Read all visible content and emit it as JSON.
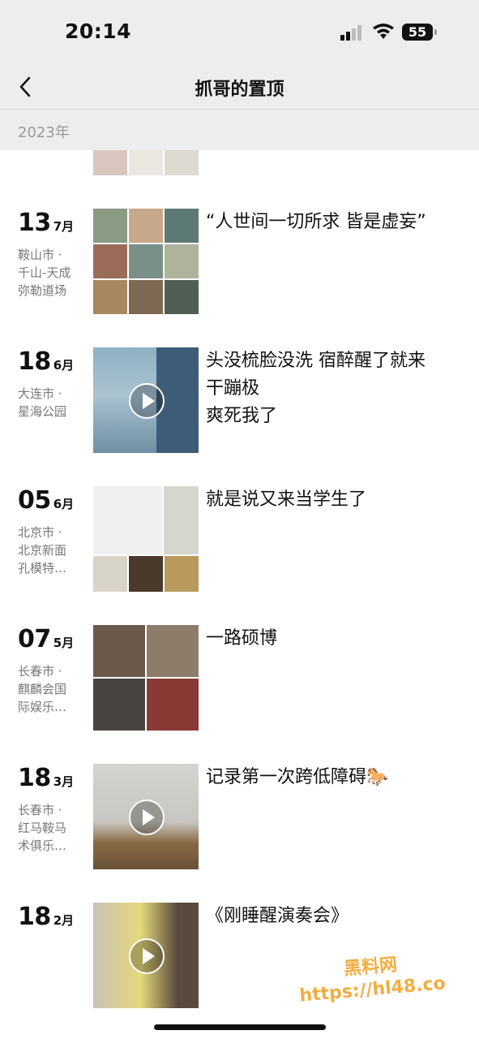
{
  "status_bar": {
    "time": "20:14",
    "battery": "55"
  },
  "nav": {
    "title": "抓哥的置顶"
  },
  "year_header": "2023年",
  "posts": [
    {
      "day": "13",
      "month": "7月",
      "location": "鞍山市 · 千山-天成弥勒道场",
      "location_lines": [
        "鞍山市 ·",
        "千山-天成",
        "弥勒道场"
      ],
      "caption": "“人世间一切所求 皆是虚妄”",
      "media": "photo-grid",
      "photo_count": 9
    },
    {
      "day": "18",
      "month": "6月",
      "location_lines": [
        "大连市 ·",
        "星海公园"
      ],
      "caption": "头没梳脸没洗 宿醉醒了就来干蹦极\n爽死我了",
      "caption_lines": [
        "头没梳脸没洗 宿醉醒了就来",
        "干蹦极",
        "爽死我了"
      ],
      "media": "video"
    },
    {
      "day": "05",
      "month": "6月",
      "location_lines": [
        "北京市 ·",
        "北京新面",
        "孔模特…"
      ],
      "caption": "就是说又来当学生了",
      "media": "photo-grid",
      "photo_count": 5
    },
    {
      "day": "07",
      "month": "5月",
      "location_lines": [
        "长春市 ·",
        "麒麟会国",
        "际娱乐…"
      ],
      "caption": "一路硕博",
      "media": "photo-grid",
      "photo_count": 4
    },
    {
      "day": "18",
      "month": "3月",
      "location_lines": [
        "长春市 ·",
        "红马鞍马",
        "术俱乐…"
      ],
      "caption": "记录第一次跨低障碍🐎",
      "media": "video"
    },
    {
      "day": "18",
      "month": "2月",
      "location_lines": [],
      "caption": "《刚睡醒演奏会》",
      "media": "video"
    }
  ],
  "watermark": {
    "line1": "黑料网",
    "line2": "https://hl48.co"
  }
}
